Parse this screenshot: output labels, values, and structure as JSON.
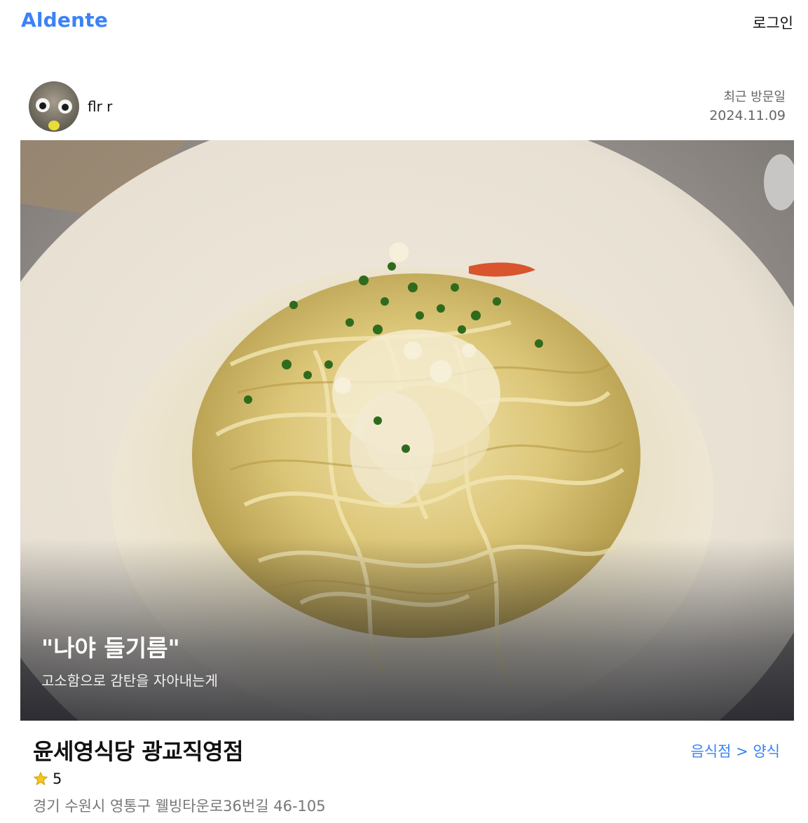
{
  "header": {
    "logo": "Aldente",
    "login_label": "로그인"
  },
  "post": {
    "author_name": "flr r",
    "visit_label": "최근 방문일",
    "visit_date": "2024.11.09",
    "caption_title": "\"나야 들기름\"",
    "caption_subtitle": "고소함으로 감탄을 자아내는게"
  },
  "restaurant": {
    "name": "윤세영식당 광교직영점",
    "category": "음식점 > 양식",
    "rating": "5",
    "address": "경기 수원시 영통구 웰빙타운로36번길 46-105"
  },
  "icons": {
    "star": "star-icon",
    "avatar": "avatar"
  },
  "colors": {
    "accent": "#3b82f6",
    "muted": "#777777",
    "star": "#f5c518"
  }
}
